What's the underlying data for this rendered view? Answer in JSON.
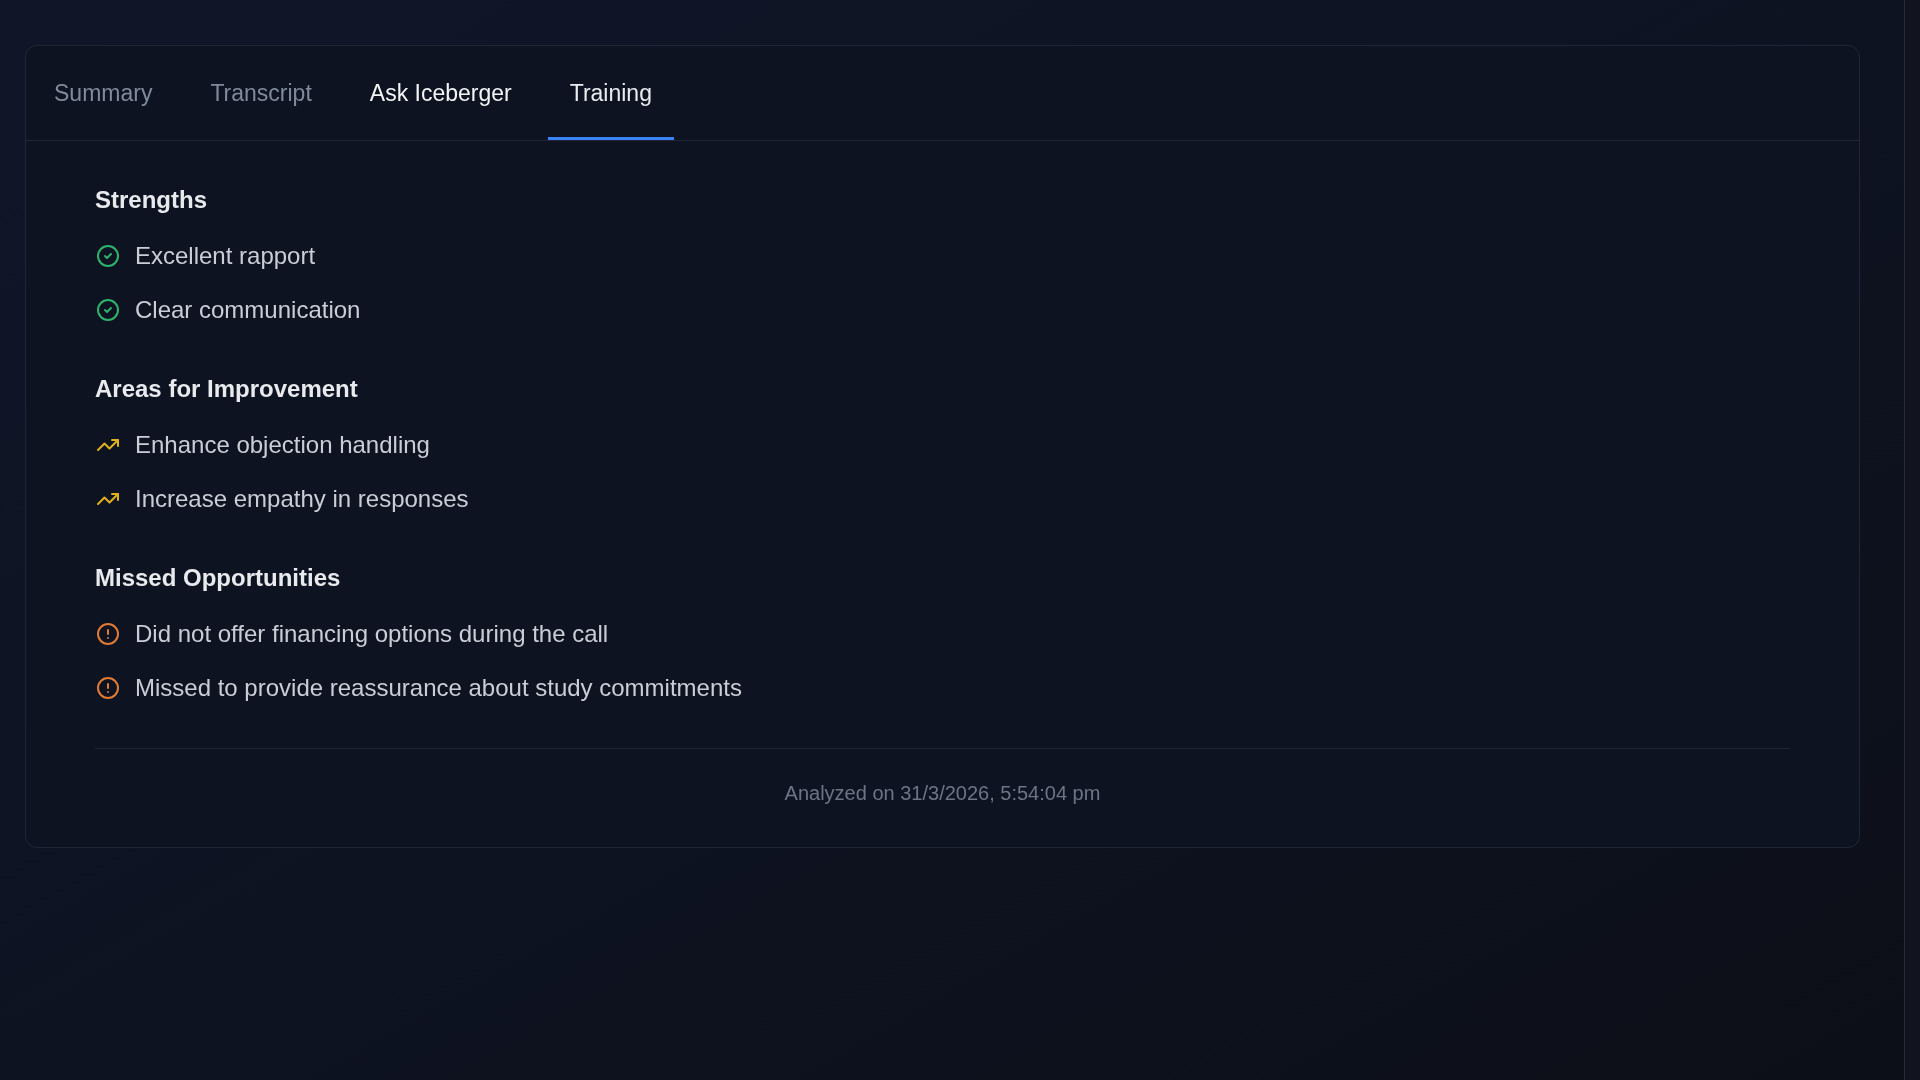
{
  "tabs": [
    {
      "label": "Summary",
      "selected": false,
      "hovered": false
    },
    {
      "label": "Transcript",
      "selected": false,
      "hovered": false
    },
    {
      "label": "Ask Iceberger",
      "selected": false,
      "hovered": true
    },
    {
      "label": "Training",
      "selected": true,
      "hovered": false
    }
  ],
  "sections": [
    {
      "title": "Strengths",
      "kind": "strength",
      "items": [
        "Excellent rapport",
        "Clear communication"
      ]
    },
    {
      "title": "Areas for Improvement",
      "kind": "improvement",
      "items": [
        "Enhance objection handling",
        "Increase empathy in responses"
      ]
    },
    {
      "title": "Missed Opportunities",
      "kind": "missed",
      "items": [
        "Did not offer financing options during the call",
        "Missed to provide reassurance about study commitments"
      ]
    }
  ],
  "footer": "Analyzed on 31/3/2026, 5:54:04 pm"
}
